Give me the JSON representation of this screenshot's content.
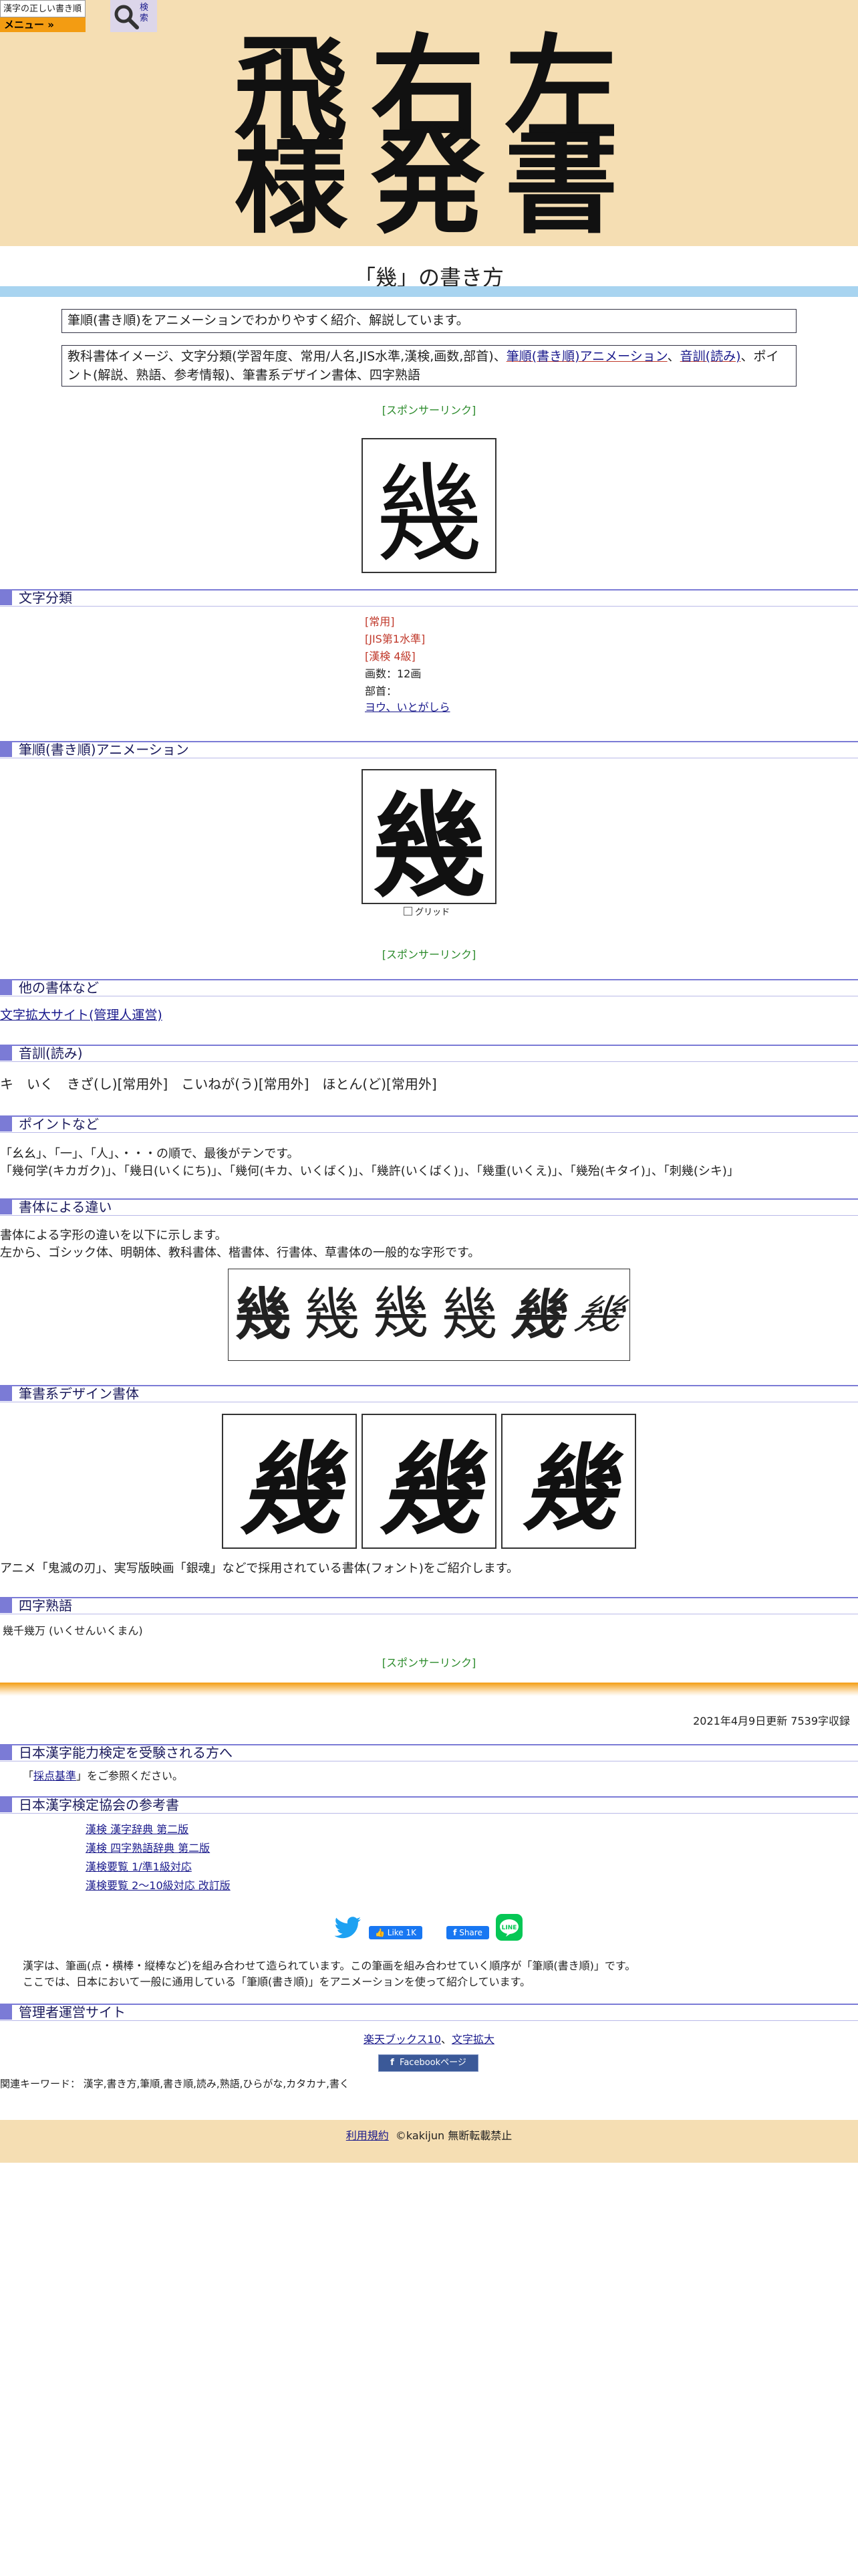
{
  "header": {
    "logo_text": "漢字の正しい書き順(筆順)",
    "menu_label": "メニュー »",
    "search_label": "検索",
    "hero_chars": [
      "飛",
      "右",
      "左",
      "様",
      "発",
      "書"
    ]
  },
  "page": {
    "title": "「幾」の書き方",
    "intro": "筆順(書き順)をアニメーションでわかりやすく紹介、解説しています。",
    "contents_intro": "教科書体イメージ、文字分類(学習年度、常用/人名,JIS水準,漢検,画数,部首)、",
    "contents_link1": "筆順(書き順)アニメーション",
    "contents_sep1": "、",
    "contents_link2": "音訓(読み)",
    "contents_tail": "、ポイント(解説、熟語、参考情報)、筆書系デザイン書体、四字熟語"
  },
  "sponsor_link": "[スポンサーリンク]",
  "kanji": "幾",
  "sections": {
    "bunrui": "文字分類",
    "animation": "筆順(書き順)アニメーション",
    "other_fonts": "他の書体など",
    "onkun": "音訓(読み)",
    "points": "ポイントなど",
    "shotai": "書体による違い",
    "fude": "筆書系デザイン書体",
    "yoji": "四字熟語",
    "kentei1": "日本漢字能力検定を受験される方へ",
    "kentei2": "日本漢字検定協会の参考書",
    "kanri": "管理者運営サイト"
  },
  "classification": {
    "joyo": "[常用]",
    "jis": "[JIS第1水準]",
    "kanken": "[漢検 4級]",
    "strokes": "画数：12画",
    "bushu_label": "部首：",
    "bushu": "ヨウ、いとがしら"
  },
  "grid_label": "グリッド",
  "other_fonts_link": "文字拡大サイト(管理人運営)",
  "onkun_text": "キ　いく　きざ(し)[常用外]　こいねが(う)[常用外]　ほとん(ど)[常用外]",
  "points_line1": "「幺幺」、「一」、「人」、・・・の順で、最後がテンです。",
  "points_line2": "「幾何学(キカガク)」、「幾日(いくにち)」、「幾何(キカ、いくばく)」、「幾許(いくばく)」、「幾重(いくえ)」、「幾殆(キタイ)」、「刺幾(シキ)」",
  "shotai_line1": "書体による字形の違いを以下に示します。",
  "shotai_line2": "左から、ゴシック体、明朝体、教科書体、楷書体、行書体、草書体の一般的な字形です。",
  "fude_caption": "アニメ「鬼滅の刃」、実写版映画「銀魂」などで採用されている書体(フォント)をご紹介します。",
  "yoji_text": "幾千幾万 (いくせんいくまん)",
  "updated": "2021年4月9日更新 7539字収録",
  "kentei_ref_prefix": "「",
  "kentei_ref_link": "採点基準",
  "kentei_ref_suffix": "」をご参照ください。",
  "books": [
    "漢検 漢字辞典 第二版",
    "漢検 四字熟語辞典 第二版",
    "漢検要覧 1/準1級対応",
    "漢検要覧 2～10級対応 改訂版"
  ],
  "social": {
    "like": "Like 1K",
    "share": "Share"
  },
  "explain_line1": "漢字は、筆画(点・横棒・縦棒など)を組み合わせて造られています。この筆画を組み合わせていく順序が「筆順(書き順)」です。",
  "explain_line2": "ここでは、日本において一般に通用している「筆順(書き順)」をアニメーションを使って紹介しています。",
  "admin_link1": "楽天ブックス10",
  "admin_sep": "、",
  "admin_link2": "文字拡大",
  "fb_page": "Facebookページ",
  "keywords": "関連キーワード： 漢字,書き方,筆順,書き順,読み,熟語,ひらがな,カタカナ,書く",
  "footer_link": "利用規約",
  "footer_copy": "©kakijun 無断転載禁止",
  "colors": {
    "header_bg": "#f5deb3",
    "accent": "#7b7bd6",
    "menu": "#f39c12",
    "title_bar": "#a8d4f0"
  }
}
